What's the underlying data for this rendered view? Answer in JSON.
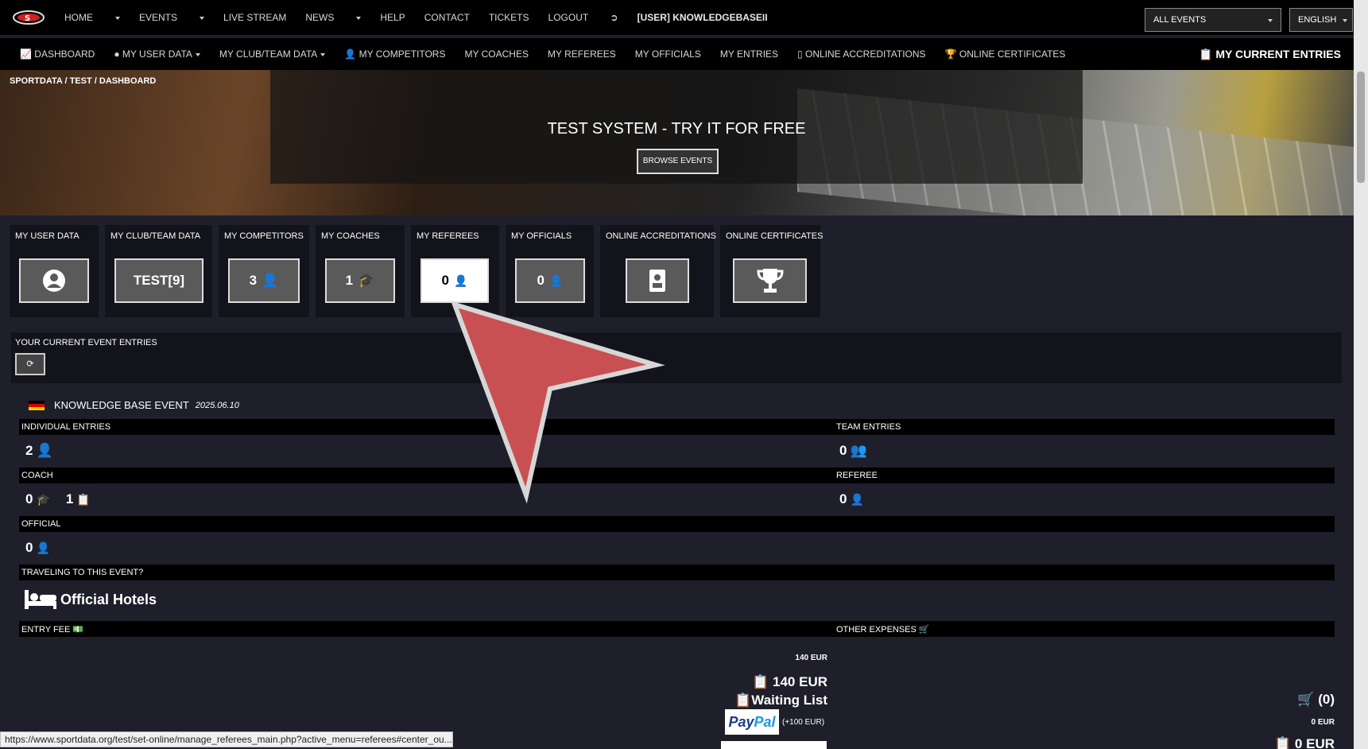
{
  "topnav": {
    "items": [
      "HOME",
      "EVENTS",
      "LIVE STREAM",
      "NEWS",
      "HELP",
      "CONTACT",
      "TICKETS",
      "LOGOUT",
      "[USER] KNOWLEDGEBASEII"
    ],
    "events_select": "ALL EVENTS",
    "language_select": "ENGLISH"
  },
  "secnav": {
    "items": [
      "DASHBOARD",
      "MY USER DATA",
      "MY CLUB/TEAM DATA",
      "MY COMPETITORS",
      "MY COACHES",
      "MY REFEREES",
      "MY OFFICIALS",
      "MY ENTRIES",
      "ONLINE ACCREDITATIONS",
      "ONLINE CERTIFICATES"
    ],
    "current_entries": "MY CURRENT ENTRIES"
  },
  "breadcrumb": [
    "SPORTDATA",
    "TEST",
    "DASHBOARD"
  ],
  "hero": {
    "title": "TEST SYSTEM - TRY IT FOR FREE",
    "button": "BROWSE EVENTS"
  },
  "tiles": [
    {
      "label": "MY USER DATA",
      "value": "",
      "icon": "user-circle-icon"
    },
    {
      "label": "MY CLUB/TEAM DATA",
      "value": "TEST[9]",
      "icon": ""
    },
    {
      "label": "MY COMPETITORS",
      "value": "3",
      "icon": "user-icon"
    },
    {
      "label": "MY COACHES",
      "value": "1",
      "icon": "coach-icon"
    },
    {
      "label": "MY REFEREES",
      "value": "0",
      "icon": "referee-icon"
    },
    {
      "label": "MY OFFICIALS",
      "value": "0",
      "icon": "official-icon"
    },
    {
      "label": "ONLINE ACCREDITATIONS",
      "value": "",
      "icon": "badge-icon"
    },
    {
      "label": "ONLINE CERTIFICATES",
      "value": "",
      "icon": "trophy-icon"
    }
  ],
  "current_entries": {
    "title": "YOUR CURRENT EVENT ENTRIES"
  },
  "event": {
    "name": "KNOWLEDGE BASE EVENT",
    "date": "2025.06.10",
    "individual_label": "INDIVIDUAL ENTRIES",
    "individual_value": "2",
    "team_label": "TEAM ENTRIES",
    "team_value": "0",
    "coach_label": "COACH",
    "coach_value_1": "0",
    "coach_value_2": "1",
    "referee_label": "REFEREE",
    "referee_value": "0",
    "official_label": "OFFICIAL",
    "official_value": "0",
    "travel_label": "TRAVELING TO THIS EVENT?",
    "hotels": "Official Hotels",
    "entry_fee_label": "ENTRY FEE",
    "other_expenses_label": "OTHER EXPENSES",
    "fee_small": "140 EUR",
    "fee_big": "140 EUR",
    "waiting_list": "Waiting List",
    "paypal_note": "(+100 EUR)",
    "cart": "(0)",
    "other_small": "0 EUR",
    "other_big": "0 EUR"
  },
  "paypal_logo": {
    "part1": "Pay",
    "part2": "Pal"
  },
  "status_url": "https://www.sportdata.org/test/set-online/manage_referees_main.php?active_menu=referees#center_ou..."
}
